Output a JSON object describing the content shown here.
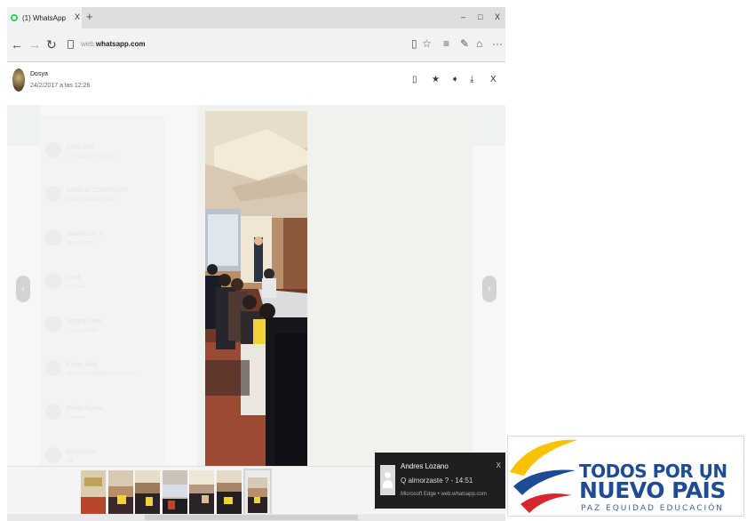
{
  "browser": {
    "tab": {
      "title": "(1) WhatsApp",
      "close": "X",
      "new_tab": "+"
    },
    "window_controls": {
      "minimize": "–",
      "maximize": "□",
      "close": "X"
    },
    "nav": {
      "back": "←",
      "forward": "→",
      "refresh": "↻"
    },
    "address": {
      "prefix": "web.",
      "domain": "whatsapp.com"
    },
    "toolbar": {
      "reading_view": "▯",
      "favorite": "☆",
      "hub": "≡",
      "notes": "✎",
      "share": "⌂",
      "more": "···"
    }
  },
  "viewer": {
    "sender": "Dosya",
    "datetime": "24/2/2017 a las 12:26",
    "tools": {
      "reply": "▯",
      "star": "★",
      "forward": "➧",
      "download": "⤓",
      "close": "X"
    },
    "prev_arrow": "‹",
    "next_arrow": "›",
    "background_chats": [
      {
        "name": "Lady Jhoi",
        "msg": "Lo copiamos a todos"
      },
      {
        "name": "FAMILIA CORREDOR",
        "msg": "te hace falta el baño"
      },
      {
        "name": "Guarnicion Jf",
        "msg": "Nena santé"
      },
      {
        "name": "Chali",
        "msg": "Gracias"
      },
      {
        "name": "Dosyre Tarfe",
        "msg": "Gracias bebe"
      },
      {
        "name": "Edgar Brito",
        "msg": "No me ha llegado a mi mismo"
      },
      {
        "name": "Diana Rivero",
        "msg": "Gracias"
      },
      {
        "name": "Eva Gallas",
        "msg": "Ok"
      },
      {
        "name": "Sorbro",
        "msg": ""
      }
    ],
    "thumbnail_count": 7,
    "selected_thumbnail": 6
  },
  "notification": {
    "title": "Andres Lozano",
    "message": "Q almorzaste ? - 14:51",
    "source": "Microsoft Edge • web.whatsapp.com",
    "close": "X"
  },
  "logo": {
    "line1": "TODOS POR UN",
    "line2": "NUEVO PAÍS",
    "line3": "PAZ  EQUIDAD  EDUCACIÓN",
    "colors": {
      "yellow": "#f7c200",
      "blue": "#1d4c94",
      "red": "#d7262d"
    }
  }
}
